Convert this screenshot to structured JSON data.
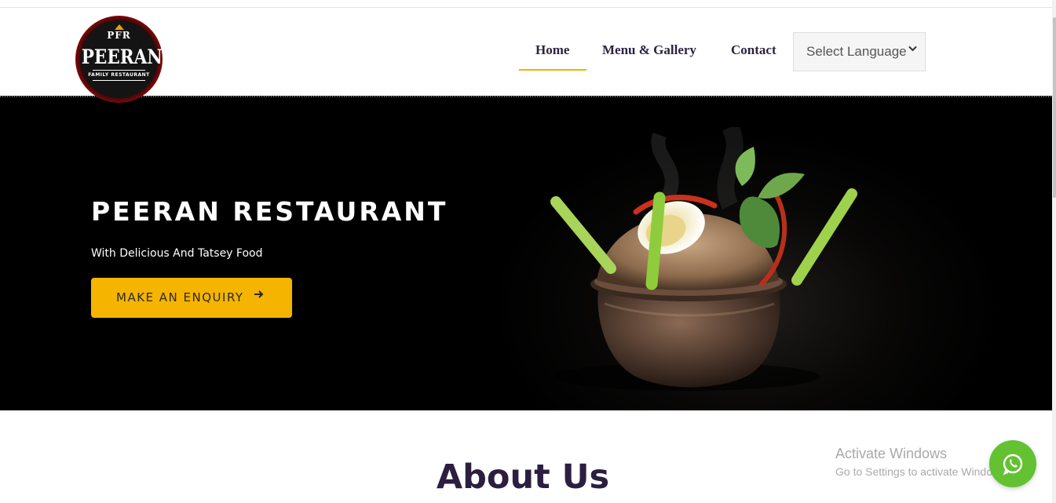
{
  "brand": {
    "monogram": "PFR",
    "name": "PEERAN",
    "tagline": "FAMILY RESTAURANT"
  },
  "nav": {
    "items": [
      {
        "label": "Home",
        "active": true
      },
      {
        "label": "Menu & Gallery",
        "active": false
      },
      {
        "label": "Contact",
        "active": false
      }
    ],
    "language_select": {
      "selected": "Select Language",
      "icon": "chevron-down-icon"
    }
  },
  "hero": {
    "title": "PEERAN RESTAURANT",
    "subtitle": "With Delicious And Tatsey Food",
    "cta_label": "MAKE AN ENQUIRY",
    "cta_icon": "arrow-right-icon"
  },
  "about": {
    "title": "About Us"
  },
  "os_watermark": {
    "line1": "Activate Windows",
    "line2": "Go to Settings to activate Windows."
  },
  "whatsapp": {
    "icon": "whatsapp-icon"
  },
  "colors": {
    "accent": "#f5b400",
    "nav_text": "#2c2440",
    "hero_bg": "#000000",
    "whatsapp": "#63c132",
    "heading": "#2b1e40"
  }
}
